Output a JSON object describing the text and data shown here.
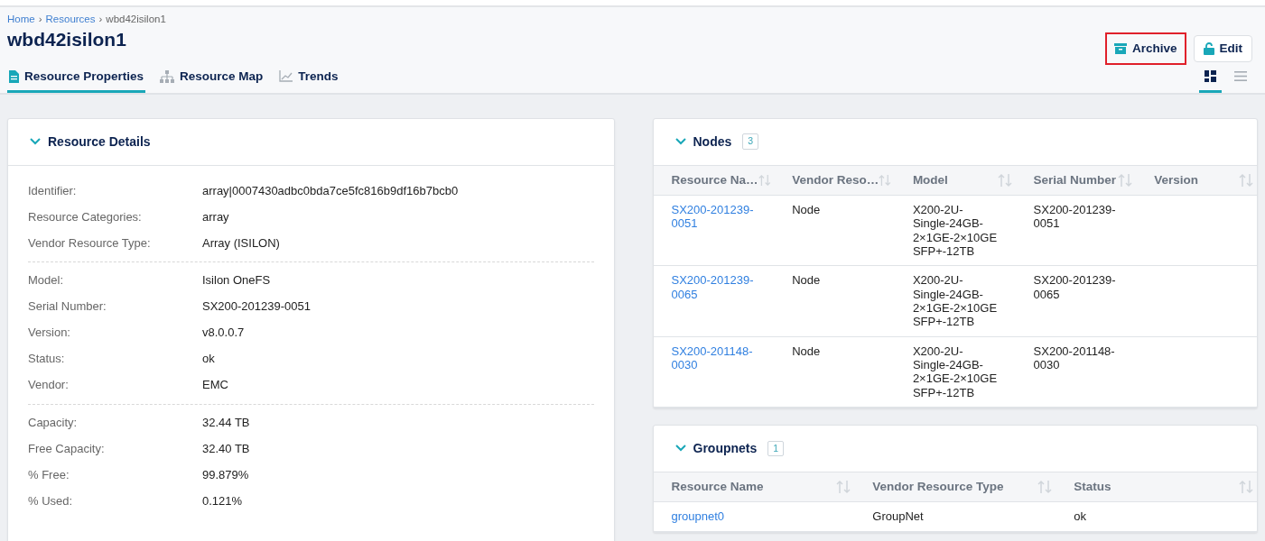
{
  "breadcrumb": [
    {
      "label": "Home",
      "kind": "link"
    },
    {
      "label": "›",
      "kind": "separator"
    },
    {
      "label": "Resources",
      "kind": "link"
    },
    {
      "label": "›",
      "kind": "separator"
    },
    {
      "label": "wbd42isilon1",
      "kind": "current"
    }
  ],
  "title": "wbd42isilon1",
  "actions": [
    {
      "label": "Archive",
      "highlighted": true
    },
    {
      "label": "Edit",
      "highlighted": false
    }
  ],
  "tabs": [
    {
      "label": "Resource Properties",
      "selected": true
    },
    {
      "label": "Resource Map",
      "selected": false
    },
    {
      "label": "Trends",
      "selected": false
    }
  ],
  "view_toggle": [
    {
      "selected": true
    },
    {
      "selected": false
    }
  ],
  "resource_details": {
    "title": "Resource Details",
    "expanded": true,
    "groups": [
      [
        {
          "label": "Identifier:",
          "value": "array|0007430adbc0bda7ce5fc816b9df16b7bcb0"
        },
        {
          "label": "Resource Categories:",
          "value": "array"
        },
        {
          "label": "Vendor Resource Type:",
          "value": "Array (ISILON)"
        }
      ],
      [
        {
          "label": "Model:",
          "value": "Isilon OneFS"
        },
        {
          "label": "Serial Number:",
          "value": "SX200-201239-0051"
        },
        {
          "label": "Version:",
          "value": "v8.0.0.7"
        },
        {
          "label": "Status:",
          "value": "ok"
        },
        {
          "label": "Vendor:",
          "value": "EMC"
        }
      ],
      [
        {
          "label": "Capacity:",
          "value": "32.44 TB"
        },
        {
          "label": "Free Capacity:",
          "value": "32.40 TB"
        },
        {
          "label": "% Free:",
          "value": "99.879%"
        },
        {
          "label": "% Used:",
          "value": "0.121%"
        }
      ]
    ]
  },
  "panels": [
    {
      "title": "Nodes",
      "count": "3",
      "expanded": true,
      "columns": [
        "Resource Na…",
        "Vendor Reso…",
        "Model",
        "Serial Number",
        "Version"
      ],
      "rows": [
        [
          "SX200-201239-0051",
          "Node",
          "X200-2U-Single-24GB-2×1GE-2×10GE SFP+-12TB",
          "SX200-201239-0051"
        ],
        [
          "SX200-201239-0065",
          "Node",
          "X200-2U-Single-24GB-2×1GE-2×10GE SFP+-12TB",
          "SX200-201239-0065"
        ],
        [
          "SX200-201148-0030",
          "Node",
          "X200-2U-Single-24GB-2×1GE-2×10GE SFP+-12TB",
          "SX200-201148-0030"
        ]
      ]
    },
    {
      "title": "Groupnets",
      "count": "1",
      "expanded": true,
      "columns": [
        "Resource Name",
        "Vendor Resource Type",
        "Status"
      ],
      "rows": [
        [
          "groupnet0",
          "GroupNet",
          "ok"
        ]
      ]
    }
  ]
}
